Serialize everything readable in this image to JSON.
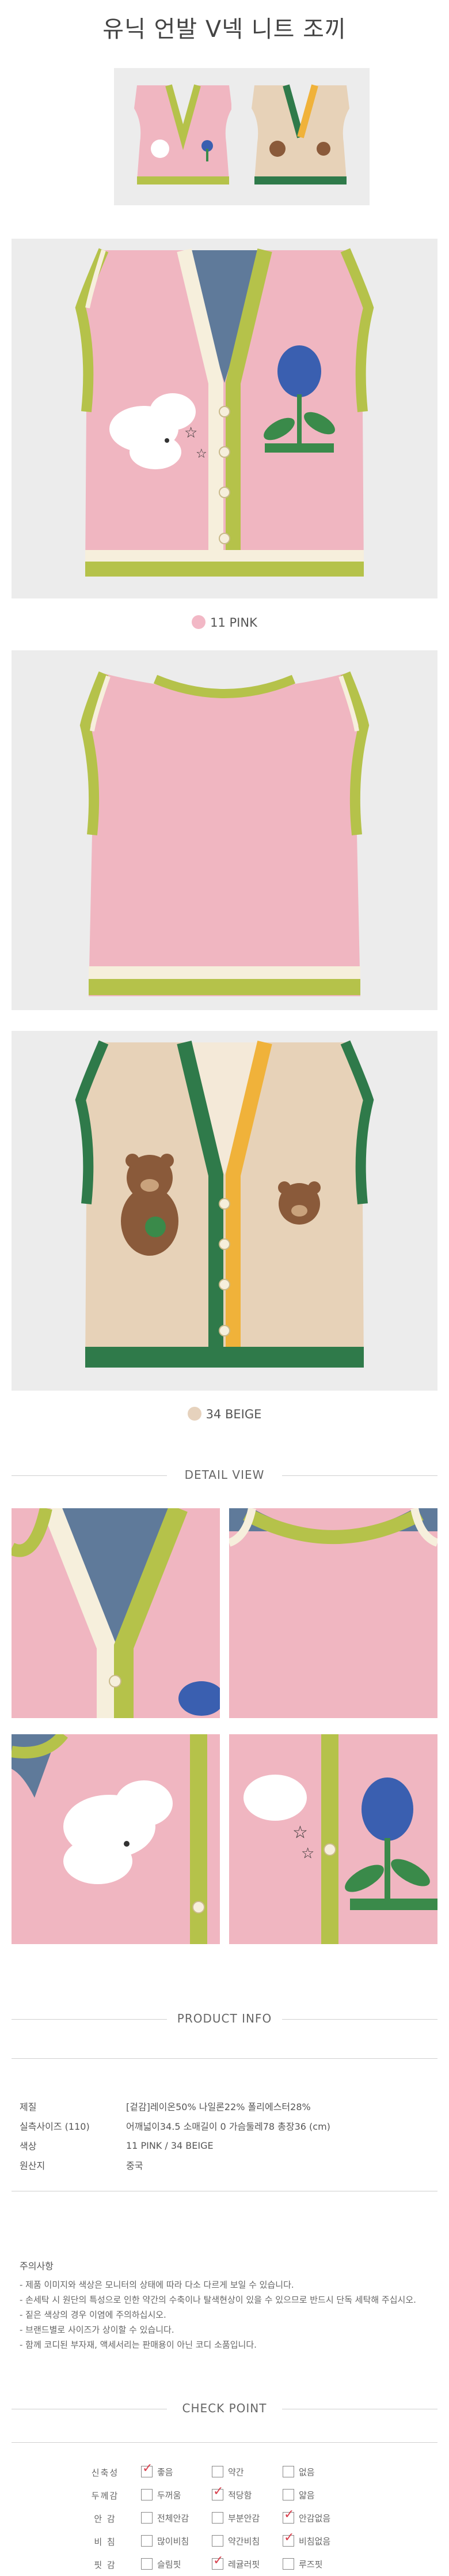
{
  "title": "유닉 언발 V넥 니트 조끼",
  "variants": [
    {
      "label": "11 PINK",
      "swatch": "#f2b8c6"
    },
    {
      "label": "34 BEIGE",
      "swatch": "#e6d2bd"
    }
  ],
  "colors": {
    "pink": "#f0b6c1",
    "olive": "#b5c24a",
    "cream": "#f6efdc",
    "beige": "#e7d2b8",
    "green": "#2f7a4a",
    "mustard": "#f0b23a",
    "denim": "#5f7a9a"
  },
  "detail_heading": "DETAIL VIEW",
  "product_info": {
    "heading": "PRODUCT INFO",
    "rows": [
      {
        "key": "제질",
        "value": "[겉감]레이온50% 나일론22% 폴리에스터28%"
      },
      {
        "key": "실측사이즈 (110)",
        "value": "어깨넓이34.5 소매길이 0 가슴둘레78 총장36 (cm)"
      },
      {
        "key": "색상",
        "value": "11 PINK / 34 BEIGE"
      },
      {
        "key": "원산지",
        "value": "중국"
      }
    ]
  },
  "notes": {
    "heading": "주의사항",
    "items": [
      "- 제품 이미지와 색상은 모니터의 상태에 따라 다소 다르게 보일 수 있습니다.",
      "- 손세탁 시 원단의 특성으로 인한 약간의 수축이나 탈색현상이 있을 수 있으므로 반드시 단독 세탁해 주십시오.",
      "- 짙은 색상의 경우 이염에 주의하십시오.",
      "- 브랜드별로 사이즈가 상이할 수 있습니다.",
      "- 함께 코디된 부자재, 액세서리는 판매용이 아닌 코디 소품입니다."
    ]
  },
  "check_point": {
    "heading": "CHECK POINT",
    "rows": [
      {
        "label": "신축성",
        "options": [
          {
            "text": "좋음",
            "checked": true
          },
          {
            "text": "약간",
            "checked": false
          },
          {
            "text": "없음",
            "checked": false
          }
        ]
      },
      {
        "label": "두께감",
        "options": [
          {
            "text": "두꺼움",
            "checked": false
          },
          {
            "text": "적당함",
            "checked": true
          },
          {
            "text": "얇음",
            "checked": false
          }
        ]
      },
      {
        "label": "안 감",
        "options": [
          {
            "text": "전체안감",
            "checked": false
          },
          {
            "text": "부분안감",
            "checked": false
          },
          {
            "text": "안감없음",
            "checked": true
          }
        ]
      },
      {
        "label": "비 침",
        "options": [
          {
            "text": "많이비침",
            "checked": false
          },
          {
            "text": "약간비침",
            "checked": false
          },
          {
            "text": "비침없음",
            "checked": true
          }
        ]
      },
      {
        "label": "핏 감",
        "options": [
          {
            "text": "슬림핏",
            "checked": false
          },
          {
            "text": "레귤러핏",
            "checked": true
          },
          {
            "text": "루즈핏",
            "checked": false
          }
        ]
      }
    ]
  }
}
